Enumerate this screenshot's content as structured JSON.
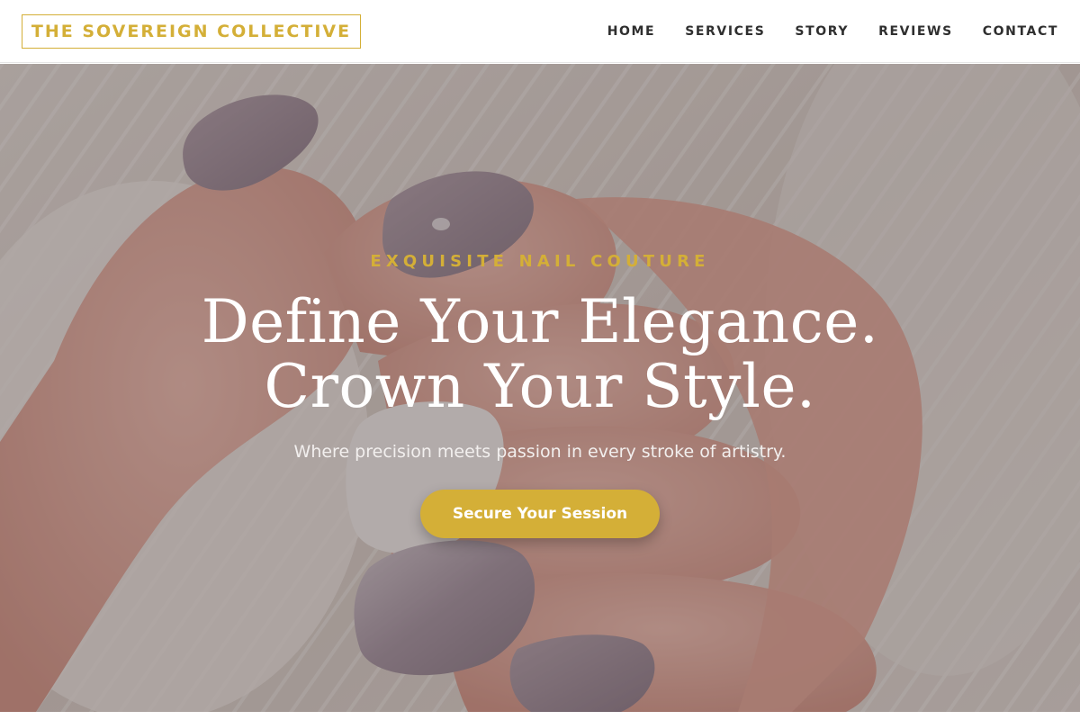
{
  "header": {
    "logo_text": "THE SOVEREIGN COLLECTIVE",
    "nav": [
      {
        "label": "HOME"
      },
      {
        "label": "SERVICES"
      },
      {
        "label": "STORY"
      },
      {
        "label": "REVIEWS"
      },
      {
        "label": "CONTACT"
      }
    ]
  },
  "hero": {
    "eyebrow": "EXQUISITE NAIL COUTURE",
    "title_line1": "Define Your Elegance.",
    "title_line2": "Crown Your Style.",
    "subtitle": "Where precision meets passion in every stroke of artistry.",
    "cta_label": "Secure Your Session"
  },
  "colors": {
    "accent_gold": "#d4af37",
    "header_bg": "#ffffff",
    "nav_text": "#2f2f2f"
  }
}
